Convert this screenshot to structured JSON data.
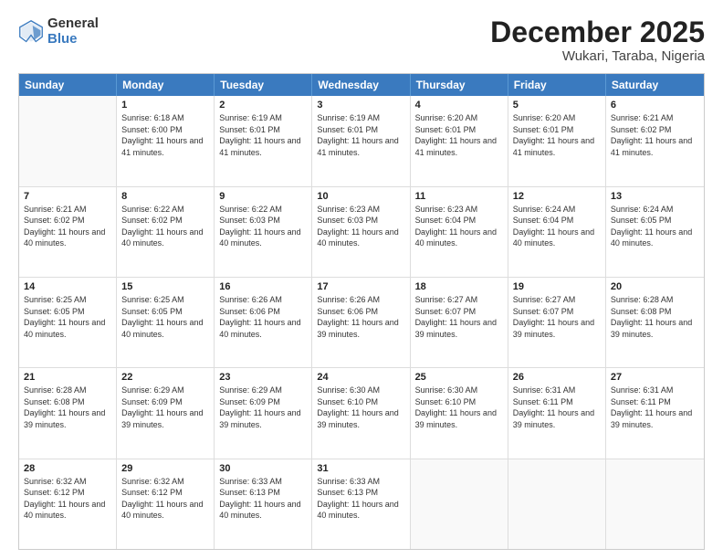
{
  "header": {
    "logo_general": "General",
    "logo_blue": "Blue",
    "title": "December 2025",
    "location": "Wukari, Taraba, Nigeria"
  },
  "calendar": {
    "days": [
      "Sunday",
      "Monday",
      "Tuesday",
      "Wednesday",
      "Thursday",
      "Friday",
      "Saturday"
    ],
    "rows": [
      [
        {
          "date": "",
          "info": ""
        },
        {
          "date": "1",
          "info": "Sunrise: 6:18 AM\nSunset: 6:00 PM\nDaylight: 11 hours\nand 41 minutes."
        },
        {
          "date": "2",
          "info": "Sunrise: 6:19 AM\nSunset: 6:01 PM\nDaylight: 11 hours\nand 41 minutes."
        },
        {
          "date": "3",
          "info": "Sunrise: 6:19 AM\nSunset: 6:01 PM\nDaylight: 11 hours\nand 41 minutes."
        },
        {
          "date": "4",
          "info": "Sunrise: 6:20 AM\nSunset: 6:01 PM\nDaylight: 11 hours\nand 41 minutes."
        },
        {
          "date": "5",
          "info": "Sunrise: 6:20 AM\nSunset: 6:01 PM\nDaylight: 11 hours\nand 41 minutes."
        },
        {
          "date": "6",
          "info": "Sunrise: 6:21 AM\nSunset: 6:02 PM\nDaylight: 11 hours\nand 41 minutes."
        }
      ],
      [
        {
          "date": "7",
          "info": "Sunrise: 6:21 AM\nSunset: 6:02 PM\nDaylight: 11 hours\nand 40 minutes."
        },
        {
          "date": "8",
          "info": "Sunrise: 6:22 AM\nSunset: 6:02 PM\nDaylight: 11 hours\nand 40 minutes."
        },
        {
          "date": "9",
          "info": "Sunrise: 6:22 AM\nSunset: 6:03 PM\nDaylight: 11 hours\nand 40 minutes."
        },
        {
          "date": "10",
          "info": "Sunrise: 6:23 AM\nSunset: 6:03 PM\nDaylight: 11 hours\nand 40 minutes."
        },
        {
          "date": "11",
          "info": "Sunrise: 6:23 AM\nSunset: 6:04 PM\nDaylight: 11 hours\nand 40 minutes."
        },
        {
          "date": "12",
          "info": "Sunrise: 6:24 AM\nSunset: 6:04 PM\nDaylight: 11 hours\nand 40 minutes."
        },
        {
          "date": "13",
          "info": "Sunrise: 6:24 AM\nSunset: 6:05 PM\nDaylight: 11 hours\nand 40 minutes."
        }
      ],
      [
        {
          "date": "14",
          "info": "Sunrise: 6:25 AM\nSunset: 6:05 PM\nDaylight: 11 hours\nand 40 minutes."
        },
        {
          "date": "15",
          "info": "Sunrise: 6:25 AM\nSunset: 6:05 PM\nDaylight: 11 hours\nand 40 minutes."
        },
        {
          "date": "16",
          "info": "Sunrise: 6:26 AM\nSunset: 6:06 PM\nDaylight: 11 hours\nand 40 minutes."
        },
        {
          "date": "17",
          "info": "Sunrise: 6:26 AM\nSunset: 6:06 PM\nDaylight: 11 hours\nand 39 minutes."
        },
        {
          "date": "18",
          "info": "Sunrise: 6:27 AM\nSunset: 6:07 PM\nDaylight: 11 hours\nand 39 minutes."
        },
        {
          "date": "19",
          "info": "Sunrise: 6:27 AM\nSunset: 6:07 PM\nDaylight: 11 hours\nand 39 minutes."
        },
        {
          "date": "20",
          "info": "Sunrise: 6:28 AM\nSunset: 6:08 PM\nDaylight: 11 hours\nand 39 minutes."
        }
      ],
      [
        {
          "date": "21",
          "info": "Sunrise: 6:28 AM\nSunset: 6:08 PM\nDaylight: 11 hours\nand 39 minutes."
        },
        {
          "date": "22",
          "info": "Sunrise: 6:29 AM\nSunset: 6:09 PM\nDaylight: 11 hours\nand 39 minutes."
        },
        {
          "date": "23",
          "info": "Sunrise: 6:29 AM\nSunset: 6:09 PM\nDaylight: 11 hours\nand 39 minutes."
        },
        {
          "date": "24",
          "info": "Sunrise: 6:30 AM\nSunset: 6:10 PM\nDaylight: 11 hours\nand 39 minutes."
        },
        {
          "date": "25",
          "info": "Sunrise: 6:30 AM\nSunset: 6:10 PM\nDaylight: 11 hours\nand 39 minutes."
        },
        {
          "date": "26",
          "info": "Sunrise: 6:31 AM\nSunset: 6:11 PM\nDaylight: 11 hours\nand 39 minutes."
        },
        {
          "date": "27",
          "info": "Sunrise: 6:31 AM\nSunset: 6:11 PM\nDaylight: 11 hours\nand 39 minutes."
        }
      ],
      [
        {
          "date": "28",
          "info": "Sunrise: 6:32 AM\nSunset: 6:12 PM\nDaylight: 11 hours\nand 40 minutes."
        },
        {
          "date": "29",
          "info": "Sunrise: 6:32 AM\nSunset: 6:12 PM\nDaylight: 11 hours\nand 40 minutes."
        },
        {
          "date": "30",
          "info": "Sunrise: 6:33 AM\nSunset: 6:13 PM\nDaylight: 11 hours\nand 40 minutes."
        },
        {
          "date": "31",
          "info": "Sunrise: 6:33 AM\nSunset: 6:13 PM\nDaylight: 11 hours\nand 40 minutes."
        },
        {
          "date": "",
          "info": ""
        },
        {
          "date": "",
          "info": ""
        },
        {
          "date": "",
          "info": ""
        }
      ]
    ]
  }
}
